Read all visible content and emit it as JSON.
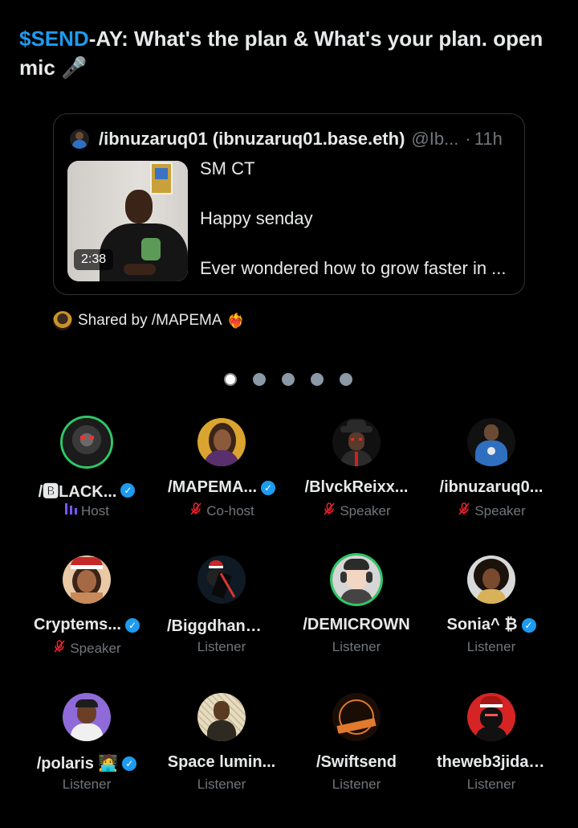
{
  "space": {
    "title_accent": "$SEND",
    "title_rest": "-AY: What's the plan & What's your plan. open mic 🎤"
  },
  "shared_post": {
    "author": "/ibnuzaruq01 (ibnuzaruq01.base.eth)",
    "handle": "@Ib...",
    "dot": "·",
    "time": "11h",
    "video_duration": "2:38",
    "lines": [
      "SM CT",
      "Happy senday",
      "Ever wondered how to grow faster in ..."
    ]
  },
  "shared_by": {
    "label": "Shared by /MAPEMA",
    "emoji": "❤️‍🔥"
  },
  "pager": {
    "pages": 5,
    "active": 0
  },
  "participants": [
    {
      "name": "/🅱LACK...",
      "verified": true,
      "role": "Host",
      "role_icon": "speaking-bars-icon",
      "ring": true,
      "avatar_icon": "robot-warrior-avatar"
    },
    {
      "name": "/MAPEMA...",
      "verified": true,
      "role": "Co-host",
      "role_icon": "mic-muted-icon",
      "ring": false,
      "avatar_icon": "woman-gold-avatar"
    },
    {
      "name": "/BlvckReixx...",
      "verified": false,
      "role": "Speaker",
      "role_icon": "mic-muted-icon",
      "ring": false,
      "avatar_icon": "hat-man-avatar"
    },
    {
      "name": "/ibnuzaruq0...",
      "verified": false,
      "role": "Speaker",
      "role_icon": "mic-muted-icon",
      "ring": false,
      "avatar_icon": "man-blue-shirt-avatar"
    },
    {
      "name": "Cryptems...",
      "verified": true,
      "role": "Speaker",
      "role_icon": "mic-muted-icon",
      "ring": false,
      "avatar_icon": "santa-hat-woman-avatar"
    },
    {
      "name": "/Biggdhan💰...",
      "verified": false,
      "role": "Listener",
      "role_icon": "",
      "ring": false,
      "avatar_icon": "santa-ninja-avatar"
    },
    {
      "name": "/DEMICROWN",
      "verified": false,
      "role": "Listener",
      "role_icon": "",
      "ring": true,
      "avatar_icon": "headphones-anime-avatar"
    },
    {
      "name": "Sonia^ ₿",
      "verified": true,
      "role": "Listener",
      "role_icon": "",
      "ring": false,
      "avatar_icon": "curly-hair-girl-avatar"
    },
    {
      "name": "/polaris 🧑‍💻",
      "verified": true,
      "role": "Listener",
      "role_icon": "",
      "ring": false,
      "avatar_icon": "purple-cap-avatar"
    },
    {
      "name": "Space lumin...",
      "verified": false,
      "role": "Listener",
      "role_icon": "",
      "ring": false,
      "avatar_icon": "sketch-man-avatar"
    },
    {
      "name": "/Swiftsend",
      "verified": false,
      "role": "Listener",
      "role_icon": "",
      "ring": false,
      "avatar_icon": "swiftsend-logo-avatar"
    },
    {
      "name": "theweb3jida....",
      "verified": false,
      "role": "Listener",
      "role_icon": "",
      "ring": false,
      "avatar_icon": "red-santa-ninja-avatar"
    }
  ],
  "colors": {
    "accent": "#1d9bf0",
    "verified": "#1d9bf0",
    "muted_mic": "#f4212e",
    "host_bars": "#7856ff",
    "speaking_ring": "#2ec866",
    "secondary_text": "#71767b"
  }
}
